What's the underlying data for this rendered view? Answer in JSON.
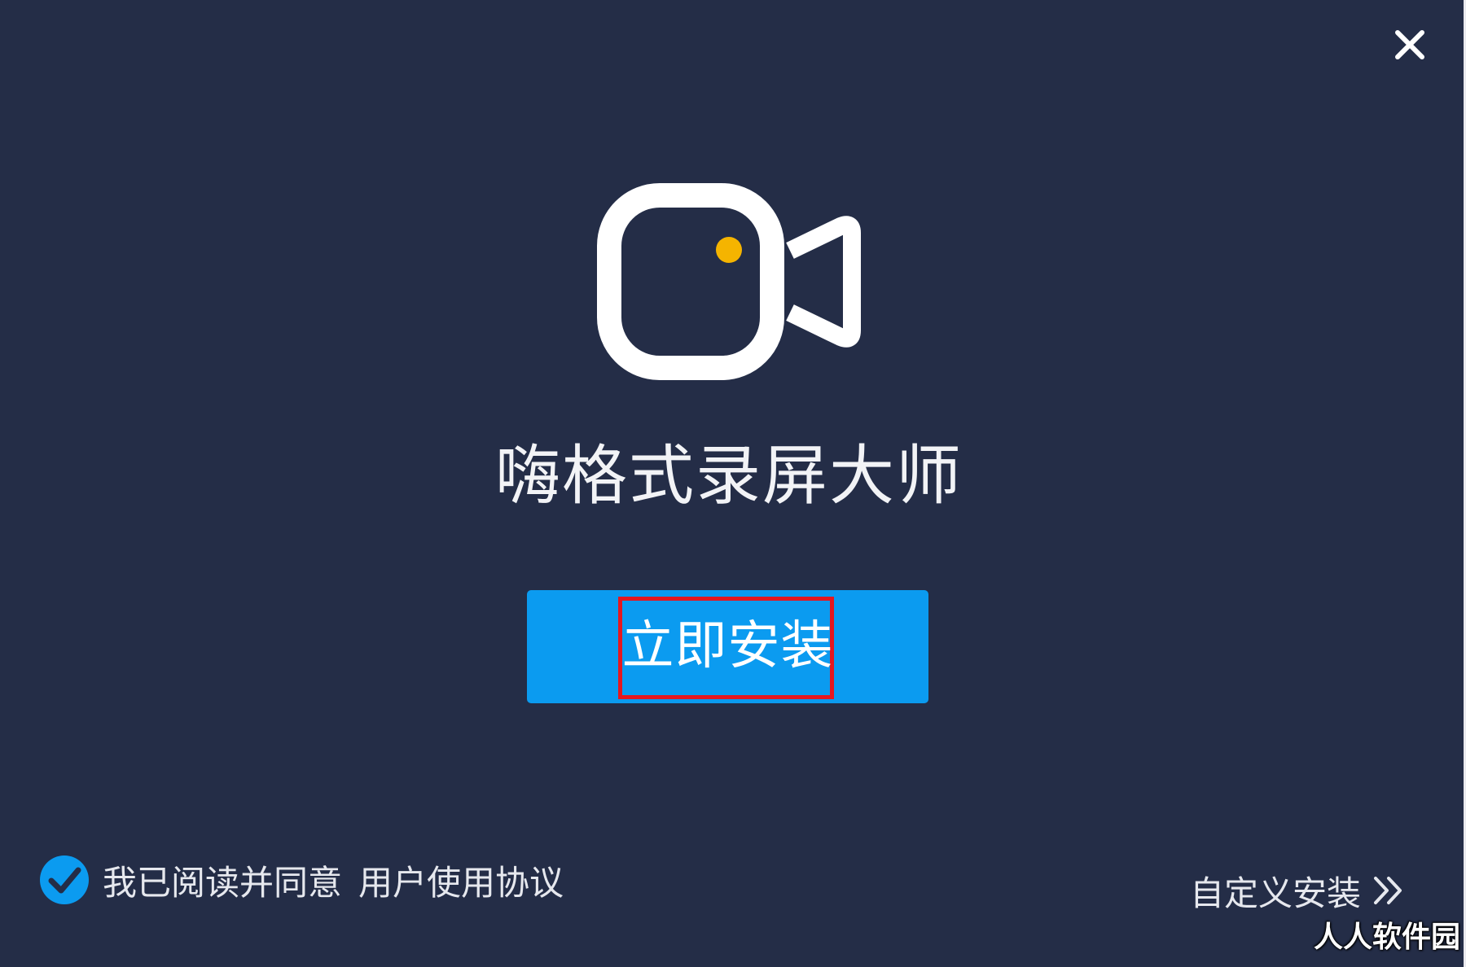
{
  "window": {
    "background": "#242d47",
    "close_icon": "close-icon"
  },
  "logo": {
    "icon": "video-camera-icon",
    "dot_color": "#f5b400"
  },
  "app": {
    "title": "嗨格式录屏大师"
  },
  "install_button": {
    "label": "立即安装",
    "color": "#0b9bf0",
    "highlight_color": "#e5171f"
  },
  "agreement": {
    "checked": true,
    "check_icon": "check-circle-icon",
    "text": "我已阅读并同意",
    "link": "用户使用协议"
  },
  "custom_install": {
    "label": "自定义安装",
    "icon": "double-chevron-right-icon"
  },
  "watermark": {
    "text": "人人软件园"
  }
}
